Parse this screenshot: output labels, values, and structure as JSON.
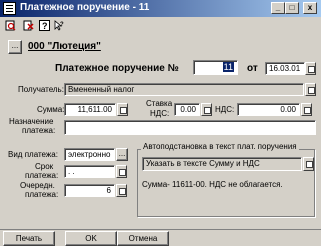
{
  "window": {
    "title": "Платежное поручение - 11",
    "min_glyph": "_",
    "max_glyph": "□",
    "close_glyph": "x"
  },
  "toolbar": {
    "icons": [
      "print-preview-icon",
      "print-icon",
      "help-icon",
      "pointer-help-icon"
    ]
  },
  "header": {
    "org_button_label": "...",
    "org_name": "000 \"Лютеция\"",
    "doc_title": "Платежное поручение №",
    "doc_number": "11",
    "from_label": "от",
    "doc_date": "16.03.01"
  },
  "form": {
    "recipient_label": "Получатель:",
    "recipient_value": "Вмененный налог",
    "sum_label": "Сумма:",
    "sum_value": "11,611.00",
    "vat_rate_label_line1": "Ставка",
    "vat_rate_label_line2": "НДС:",
    "vat_rate_value": "0.00",
    "vat_label": "НДС:",
    "vat_value": "0.00",
    "purpose_label_line1": "Назначение",
    "purpose_label_line2": "платежа:",
    "purpose_value": "",
    "payment_type_label": "Вид платежа:",
    "payment_type_value": "электронно",
    "term_label_line1": "Срок",
    "term_label_line2": "платежа:",
    "term_value": ". .",
    "priority_label_line1": "Очередн.",
    "priority_label_line2": "платежа:",
    "priority_value": "6"
  },
  "auto_group": {
    "caption": "Автоподстановка в текст плат. поручения",
    "selected": "Указать в тексте Сумму и НДС",
    "result_text": "Сумма- 11611-00. НДС не облагается."
  },
  "footer": {
    "print_label": "Печать",
    "ok_label": "OK",
    "cancel_label": "Отмена"
  }
}
